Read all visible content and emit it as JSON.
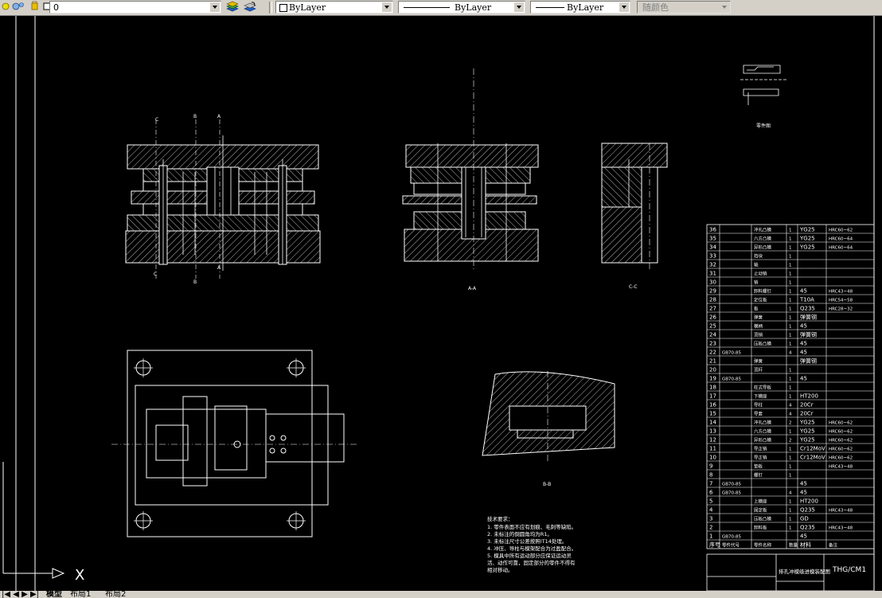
{
  "toolbar": {
    "layer_value": "0",
    "color_value": "ByLayer",
    "linetype_value": "ByLayer",
    "lineweight_value": "ByLayer",
    "plotstyle_value": "随颜色"
  },
  "drawing": {
    "view_labels": {
      "section_a": "A-A",
      "section_b": "B-B",
      "section_c": "C-C",
      "part_drawing": "零件图",
      "cut_a": "A",
      "cut_b": "B",
      "cut_c": "C"
    },
    "notes": {
      "title": "技术要求：",
      "lines": [
        "1. 零件表面不应有划痕、毛刺等缺陷。",
        "2. 未标注的倒圆角均为R1。",
        "3. 未标注尺寸公差按照IT14处理。",
        "4. 冲压、导柱与模架配合为过盈配合。",
        "5. 模具中所有运动部分应保证运动灵",
        "活、动作可靠，固定部分的零件不得有",
        "相对移动。"
      ]
    },
    "bom": {
      "rows": [
        {
          "no": "36",
          "std": "",
          "name": "冲孔凸模",
          "qty": "1",
          "mat": "YG25",
          "remark": "HRC60~62"
        },
        {
          "no": "35",
          "std": "",
          "name": "六方凸模",
          "qty": "1",
          "mat": "YG25",
          "remark": "HRC60~64"
        },
        {
          "no": "34",
          "std": "",
          "name": "异形凸模",
          "qty": "1",
          "mat": "YG25",
          "remark": "HRC60~64"
        },
        {
          "no": "33",
          "std": "",
          "name": "挡块",
          "qty": "1",
          "mat": "",
          "remark": ""
        },
        {
          "no": "32",
          "std": "",
          "name": "轴",
          "qty": "1",
          "mat": "",
          "remark": ""
        },
        {
          "no": "31",
          "std": "",
          "name": "止动销",
          "qty": "1",
          "mat": "",
          "remark": ""
        },
        {
          "no": "30",
          "std": "",
          "name": "销",
          "qty": "1",
          "mat": "",
          "remark": ""
        },
        {
          "no": "29",
          "std": "",
          "name": "卸料螺钉",
          "qty": "1",
          "mat": "45",
          "remark": "HRC43~48"
        },
        {
          "no": "28",
          "std": "",
          "name": "定位板",
          "qty": "1",
          "mat": "T10A",
          "remark": "HRC54~58"
        },
        {
          "no": "27",
          "std": "",
          "name": "板",
          "qty": "1",
          "mat": "Q235",
          "remark": "HRC28~32"
        },
        {
          "no": "26",
          "std": "",
          "name": "弹簧",
          "qty": "1",
          "mat": "弹簧钢",
          "remark": ""
        },
        {
          "no": "25",
          "std": "",
          "name": "模柄",
          "qty": "1",
          "mat": "45",
          "remark": ""
        },
        {
          "no": "24",
          "std": "",
          "name": "顶销",
          "qty": "1",
          "mat": "弹簧钢",
          "remark": ""
        },
        {
          "no": "23",
          "std": "",
          "name": "压板凸模",
          "qty": "1",
          "mat": "45",
          "remark": ""
        },
        {
          "no": "22",
          "std": "GB70-85",
          "name": "",
          "qty": "4",
          "mat": "45",
          "remark": ""
        },
        {
          "no": "21",
          "std": "",
          "name": "弹簧",
          "qty": "",
          "mat": "弹簧钢",
          "remark": ""
        },
        {
          "no": "20",
          "std": "",
          "name": "顶杆",
          "qty": "1",
          "mat": "",
          "remark": ""
        },
        {
          "no": "19",
          "std": "GB70-85",
          "name": "",
          "qty": "1",
          "mat": "45",
          "remark": ""
        },
        {
          "no": "18",
          "std": "",
          "name": "柱式导板",
          "qty": "1",
          "mat": "",
          "remark": ""
        },
        {
          "no": "17",
          "std": "",
          "name": "下模座",
          "qty": "1",
          "mat": "HT200",
          "remark": ""
        },
        {
          "no": "16",
          "std": "",
          "name": "导柱",
          "qty": "4",
          "mat": "20Cr",
          "remark": ""
        },
        {
          "no": "15",
          "std": "",
          "name": "导套",
          "qty": "4",
          "mat": "20Cr",
          "remark": ""
        },
        {
          "no": "14",
          "std": "",
          "name": "冲孔凸模",
          "qty": "2",
          "mat": "YG25",
          "remark": "HRC60~62"
        },
        {
          "no": "13",
          "std": "",
          "name": "六方凸模",
          "qty": "1",
          "mat": "YG25",
          "remark": "HRC60~62"
        },
        {
          "no": "12",
          "std": "",
          "name": "异形凸模",
          "qty": "2",
          "mat": "YG25",
          "remark": "HRC60~62"
        },
        {
          "no": "11",
          "std": "",
          "name": "导正销",
          "qty": "1",
          "mat": "Cr12MoV",
          "remark": "HRC60~62"
        },
        {
          "no": "10",
          "std": "",
          "name": "导正销",
          "qty": "1",
          "mat": "Cr12MoV",
          "remark": "HRC60~62"
        },
        {
          "no": "9",
          "std": "",
          "name": "垫板",
          "qty": "1",
          "mat": "",
          "remark": "HRC43~48"
        },
        {
          "no": "8",
          "std": "",
          "name": "螺钉",
          "qty": "1",
          "mat": "",
          "remark": ""
        },
        {
          "no": "7",
          "std": "GB70-85",
          "name": "",
          "qty": "",
          "mat": "45",
          "remark": ""
        },
        {
          "no": "6",
          "std": "GB70-85",
          "name": "",
          "qty": "4",
          "mat": "45",
          "remark": ""
        },
        {
          "no": "5",
          "std": "",
          "name": "上模座",
          "qty": "1",
          "mat": "HT200",
          "remark": ""
        },
        {
          "no": "4",
          "std": "",
          "name": "固定板",
          "qty": "1",
          "mat": "Q235",
          "remark": "HRC43~48"
        },
        {
          "no": "3",
          "std": "",
          "name": "压板凸模",
          "qty": "1",
          "mat": "GD",
          "remark": ""
        },
        {
          "no": "2",
          "std": "",
          "name": "卸料板",
          "qty": "1",
          "mat": "Q235",
          "remark": "HRC43~48"
        },
        {
          "no": "1",
          "std": "GB70-85",
          "name": "",
          "qty": "",
          "mat": "45",
          "remark": ""
        }
      ],
      "header": {
        "no": "序号",
        "std": "零件代号",
        "name": "零件名称",
        "qty": "数量",
        "mat": "材料",
        "remark": "备注"
      }
    },
    "title_block": {
      "drawing_no": "THG/CM1",
      "name": "排孔冲模级进模装配图"
    },
    "ucs_label": "X"
  },
  "tabs": {
    "model": "模型",
    "layout1": "布局1",
    "layout2": "布局2"
  }
}
